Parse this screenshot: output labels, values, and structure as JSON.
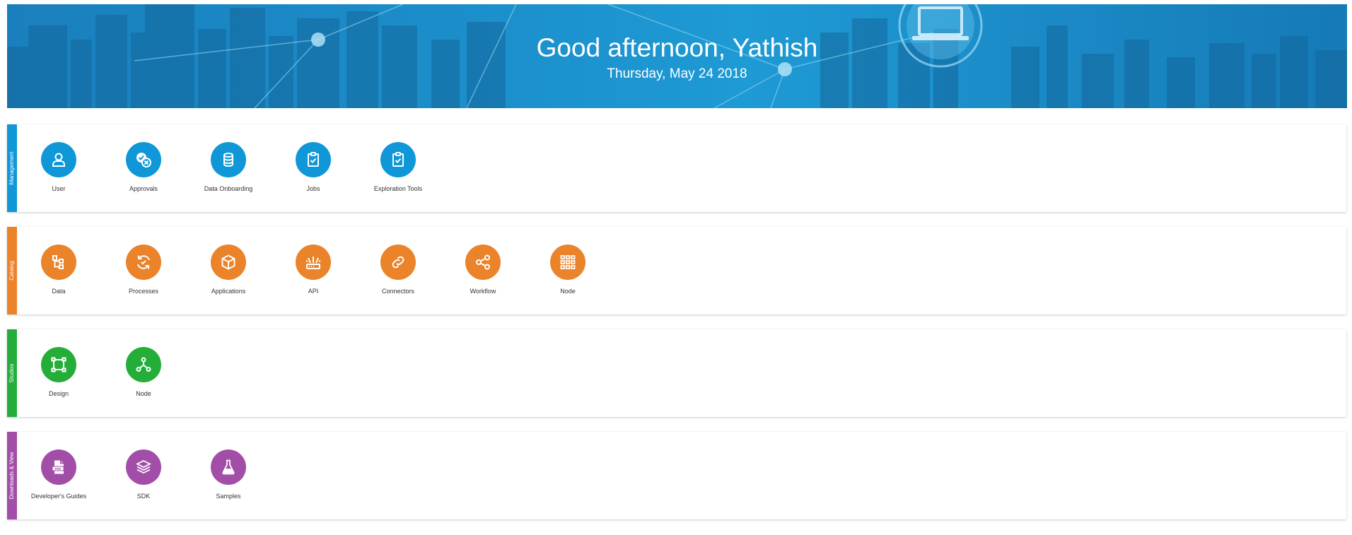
{
  "banner": {
    "greeting": "Good afternoon, Yathish",
    "date": "Thursday, May 24 2018"
  },
  "sections": {
    "management": {
      "label": "Management",
      "color": "#0f97d8",
      "items": [
        {
          "label": "User",
          "icon": "user-icon"
        },
        {
          "label": "Approvals",
          "icon": "approvals-icon"
        },
        {
          "label": "Data Onboarding",
          "icon": "database-icon"
        },
        {
          "label": "Jobs",
          "icon": "clipboard-check-icon"
        },
        {
          "label": "Exploration Tools",
          "icon": "clipboard-check-icon"
        }
      ]
    },
    "catalog": {
      "label": "Catalog",
      "color": "#ea8329",
      "items": [
        {
          "label": "Data",
          "icon": "data-tree-icon"
        },
        {
          "label": "Processes",
          "icon": "refresh-cycle-icon"
        },
        {
          "label": "Applications",
          "icon": "cube-icon"
        },
        {
          "label": "API",
          "icon": "router-icon"
        },
        {
          "label": "Connectors",
          "icon": "link-icon"
        },
        {
          "label": "Workflow",
          "icon": "share-icon"
        },
        {
          "label": "Node",
          "icon": "grid-icon"
        }
      ]
    },
    "studios": {
      "label": "Studios",
      "color": "#25ad3a",
      "items": [
        {
          "label": "Design",
          "icon": "design-frame-icon"
        },
        {
          "label": "Node",
          "icon": "node-graph-icon"
        }
      ]
    },
    "downloads": {
      "label": "Downloads & View",
      "color": "#a24ea8",
      "items": [
        {
          "label": "Developer's Guides",
          "icon": "pdf-file-icon"
        },
        {
          "label": "SDK",
          "icon": "layers-icon"
        },
        {
          "label": "Samples",
          "icon": "flask-icon"
        }
      ]
    }
  }
}
